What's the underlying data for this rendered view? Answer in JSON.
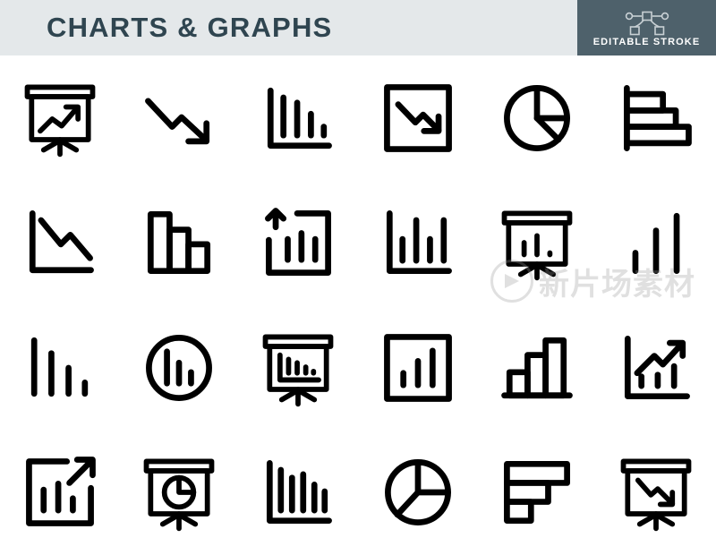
{
  "header": {
    "title": "CHARTS & GRAPHS",
    "title_color": "#2f4550",
    "background_color": "#e4e8ea",
    "badge": {
      "label": "EDITABLE STROKE",
      "background_color": "#4e616b",
      "text_color": "#ffffff",
      "icon_name": "bezier-node-icon"
    }
  },
  "watermark": {
    "text": "新片场素材",
    "logo_icon_name": "play-circle-icon",
    "color": "#9a9a9a"
  },
  "grid": {
    "columns": 6,
    "rows": 4,
    "stroke_color": "#000000",
    "icons": [
      {
        "index": 1,
        "name": "presentation-board-line-up-icon",
        "label": "Presentation board with rising line arrow"
      },
      {
        "index": 2,
        "name": "arrow-trend-down-icon",
        "label": "Downward zigzag trend arrow"
      },
      {
        "index": 3,
        "name": "bar-chart-descending-axis-icon",
        "label": "Descending bar chart with axis"
      },
      {
        "index": 4,
        "name": "framed-line-down-icon",
        "label": "Square frame with falling arrow"
      },
      {
        "index": 5,
        "name": "pie-chart-three-slice-icon",
        "label": "Pie chart, three slices"
      },
      {
        "index": 6,
        "name": "horizontal-bar-chart-ascending-icon",
        "label": "Horizontal bar chart ascending"
      },
      {
        "index": 7,
        "name": "line-chart-down-axis-icon",
        "label": "Falling line chart with axis"
      },
      {
        "index": 8,
        "name": "bar-chart-descending-solid-icon",
        "label": "Three descending outlined bars"
      },
      {
        "index": 9,
        "name": "framed-bars-up-arrow-icon",
        "label": "Framed bar chart with up arrow"
      },
      {
        "index": 10,
        "name": "bar-chart-four-bars-axis-icon",
        "label": "Four bars with axis"
      },
      {
        "index": 11,
        "name": "presentation-board-bars-icon",
        "label": "Presentation board with bars"
      },
      {
        "index": 12,
        "name": "bar-chart-ascending-plain-icon",
        "label": "Three ascending bars"
      },
      {
        "index": 13,
        "name": "bar-chart-descending-plain-icon",
        "label": "Four descending bars"
      },
      {
        "index": 14,
        "name": "circle-bar-chart-icon",
        "label": "Circle containing descending bars"
      },
      {
        "index": 15,
        "name": "presentation-board-bar-axis-icon",
        "label": "Presentation board with bar chart and axis"
      },
      {
        "index": 16,
        "name": "framed-bars-ascending-icon",
        "label": "Square frame with ascending bars"
      },
      {
        "index": 17,
        "name": "bar-chart-ascending-outline-icon",
        "label": "Three ascending outlined bars on baseline"
      },
      {
        "index": 18,
        "name": "line-chart-up-bars-axis-icon",
        "label": "Rising arrow over bars with axis"
      },
      {
        "index": 19,
        "name": "framed-bars-out-arrow-icon",
        "label": "Framed bars with outward arrow"
      },
      {
        "index": 20,
        "name": "presentation-board-pie-icon",
        "label": "Presentation board with pie chart"
      },
      {
        "index": 21,
        "name": "bar-chart-five-bars-axis-icon",
        "label": "Five descending bars with axis"
      },
      {
        "index": 22,
        "name": "pie-chart-equal-thirds-icon",
        "label": "Pie chart with three equal slices"
      },
      {
        "index": 23,
        "name": "horizontal-bar-chart-descending-icon",
        "label": "Horizontal bar chart descending"
      },
      {
        "index": 24,
        "name": "presentation-board-line-down-icon",
        "label": "Presentation board with falling arrow"
      }
    ]
  }
}
